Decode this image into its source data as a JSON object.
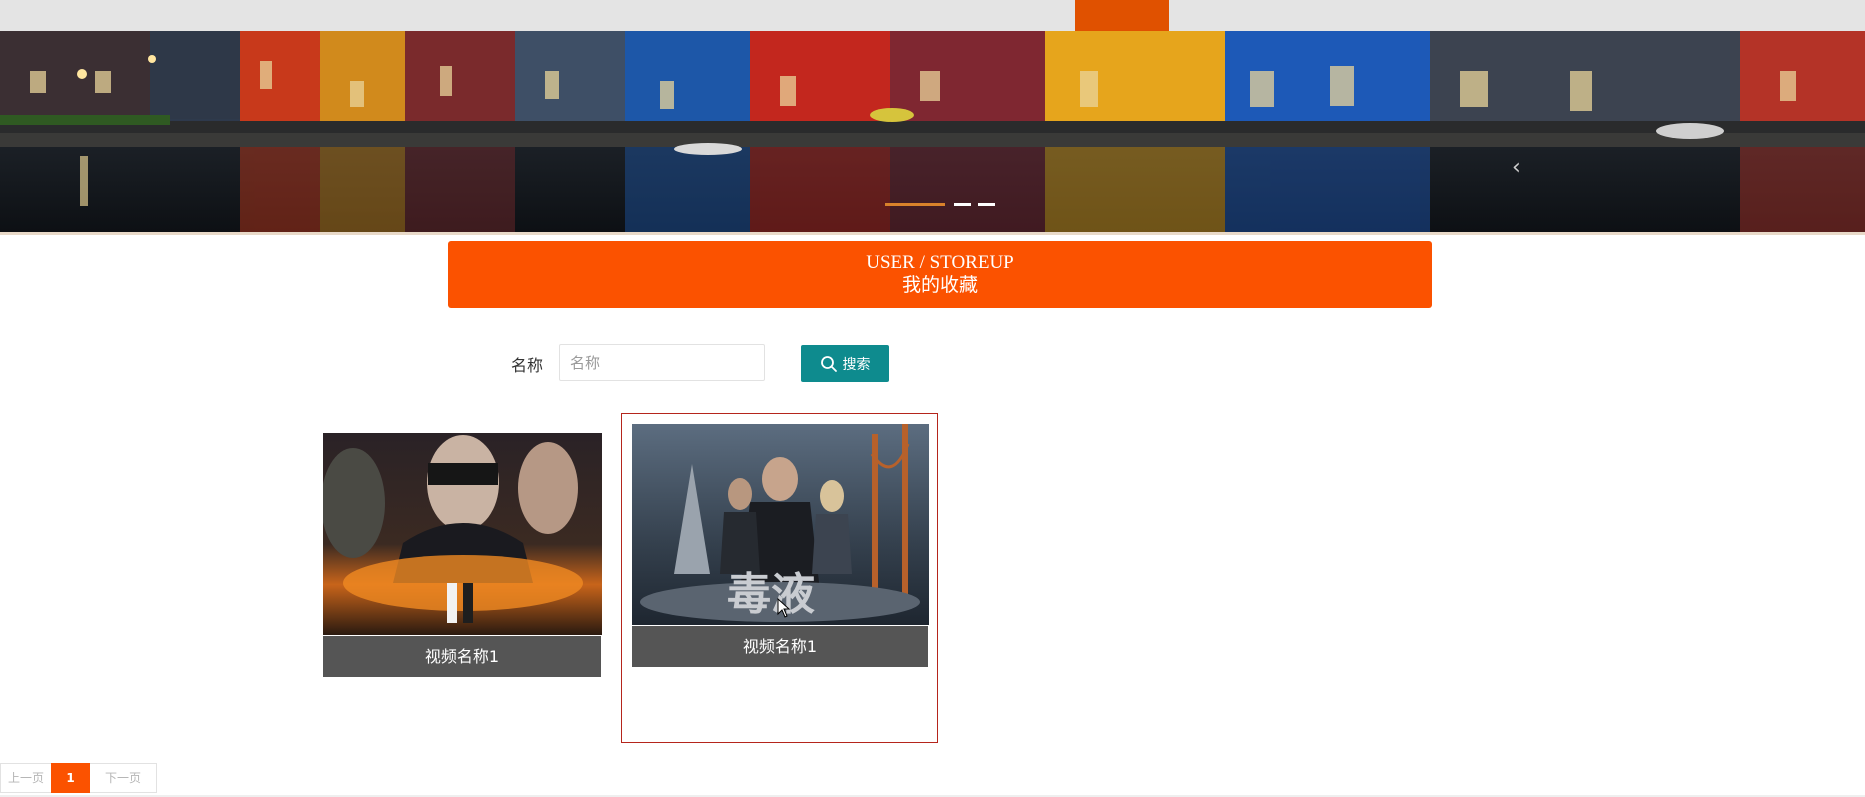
{
  "header": {
    "title_en": "USER / STOREUP",
    "title_cn": "我的收藏"
  },
  "search": {
    "label": "名称",
    "placeholder": "名称",
    "value": "",
    "button_label": "搜索",
    "button_icon": "search-icon"
  },
  "items": [
    {
      "title": "视频名称1"
    },
    {
      "title": "视频名称1"
    }
  ],
  "pagination": {
    "prev_label": "上一页",
    "current_page": "1",
    "next_label": "下一页"
  },
  "colors": {
    "accent": "#fb5200",
    "search_button": "#0e8b8e",
    "caption_bg": "#555555",
    "selected_border": "#b5251c"
  }
}
